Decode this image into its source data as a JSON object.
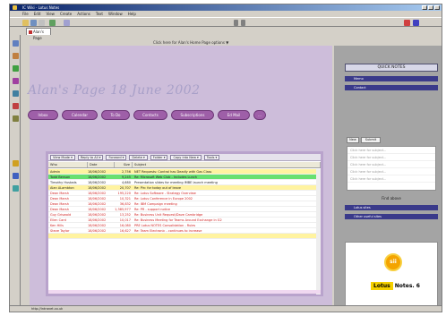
{
  "window": {
    "title": "IC Wiki - Lotus Notes"
  },
  "menubar": [
    "File",
    "Edit",
    "View",
    "Create",
    "Actions",
    "Text",
    "Window",
    "Help"
  ],
  "tab": {
    "label": "Alan's Page"
  },
  "topinfo": "Click here for Alan's Home Page options ▼",
  "page": {
    "title": "Alan's Page   18 June 2002",
    "nav": [
      "Inbox",
      "Calendar",
      "To Do",
      "Contacts",
      "Subscriptions",
      "Ed Mail",
      "..."
    ]
  },
  "grid": {
    "tools": [
      "View Mode ▾",
      "Reply to All ▾",
      "Forward ▾",
      "Delete ▾",
      "Folder ▾",
      "Copy into New ▾",
      "Tools ▾"
    ],
    "headers": [
      "Who",
      "Date",
      "Size",
      "Subject"
    ],
    "rows": [
      {
        "who": "Admin",
        "date": "18/06/2002",
        "size": "2,756",
        "subject": "NET Requests: Control has Deadly with Gas Class",
        "style": "y"
      },
      {
        "who": "Todd Benson",
        "date": "18/06/2002",
        "size": "9,245",
        "subject": "Re: Microsoft Web Club - Includes Lunch ",
        "style": "g"
      },
      {
        "who": "Timothy Hustads",
        "date": "18/06/2002",
        "size": "4,680",
        "subject": "Presentation slides for meeting IMBE launch meeting",
        "style": ""
      },
      {
        "who": "Alan ALambton",
        "date": "18/06/2002",
        "size": "20,707",
        "subject": "Re: Pin: for today out of leave",
        "style": "y"
      },
      {
        "who": "Dean Marsh",
        "date": "18/06/2002",
        "size": "195,220",
        "subject": "Re: Lotus Software - Strategy Overview",
        "style": "r"
      },
      {
        "who": "Dean Marsh",
        "date": "18/06/2002",
        "size": "10,321",
        "subject": "Re: Lotus Conference in Europe 2002",
        "style": "r"
      },
      {
        "who": "Dean Marsh",
        "date": "18/06/2002",
        "size": "36,832",
        "subject": "Re: IBM Campaign meeting",
        "style": "r"
      },
      {
        "who": "Dean Marsh",
        "date": "18/06/2002",
        "size": "1,385,977",
        "subject": "Re: PR - support notice",
        "style": "r"
      },
      {
        "who": "Guy Griswold",
        "date": "18/06/2002",
        "size": "13,252",
        "subject": "Re: Business Unit Request/Dave Cambridge",
        "style": "r"
      },
      {
        "who": "Ellen Card",
        "date": "18/06/2002",
        "size": "10,017",
        "subject": "Re: Business Meeting for Teams Around Exchange in G2",
        "style": "r"
      },
      {
        "who": "Ken Hills",
        "date": "18/06/2002",
        "size": "16,080",
        "subject": "PRE Lotus NOTES Consolidation - Rules",
        "style": "r"
      },
      {
        "who": "Steve Taylor",
        "date": "18/06/2002",
        "size": "16,627",
        "subject": "Re: Team Electronic - continues to increase ",
        "style": "r"
      },
      {
        "who": "",
        "date": "",
        "size": "",
        "subject": "",
        "style": "y"
      }
    ]
  },
  "sidebar": {
    "title": "QUICK NOTES",
    "bars": [
      "Memo",
      "Contact"
    ],
    "buttons": [
      "New",
      "Submit"
    ],
    "list": [
      "Click here for subject...",
      "Click here for subject...",
      "Click here for subject...",
      "Click here for subject...",
      "Click here for subject..."
    ],
    "find": "Find above",
    "bars2": [
      "Lotus sites",
      "Other useful sites"
    ],
    "ad": {
      "logo_text": "sii",
      "brand": "Lotus",
      "product": "Notes. 6"
    }
  },
  "status": "http://intranet.co.uk"
}
